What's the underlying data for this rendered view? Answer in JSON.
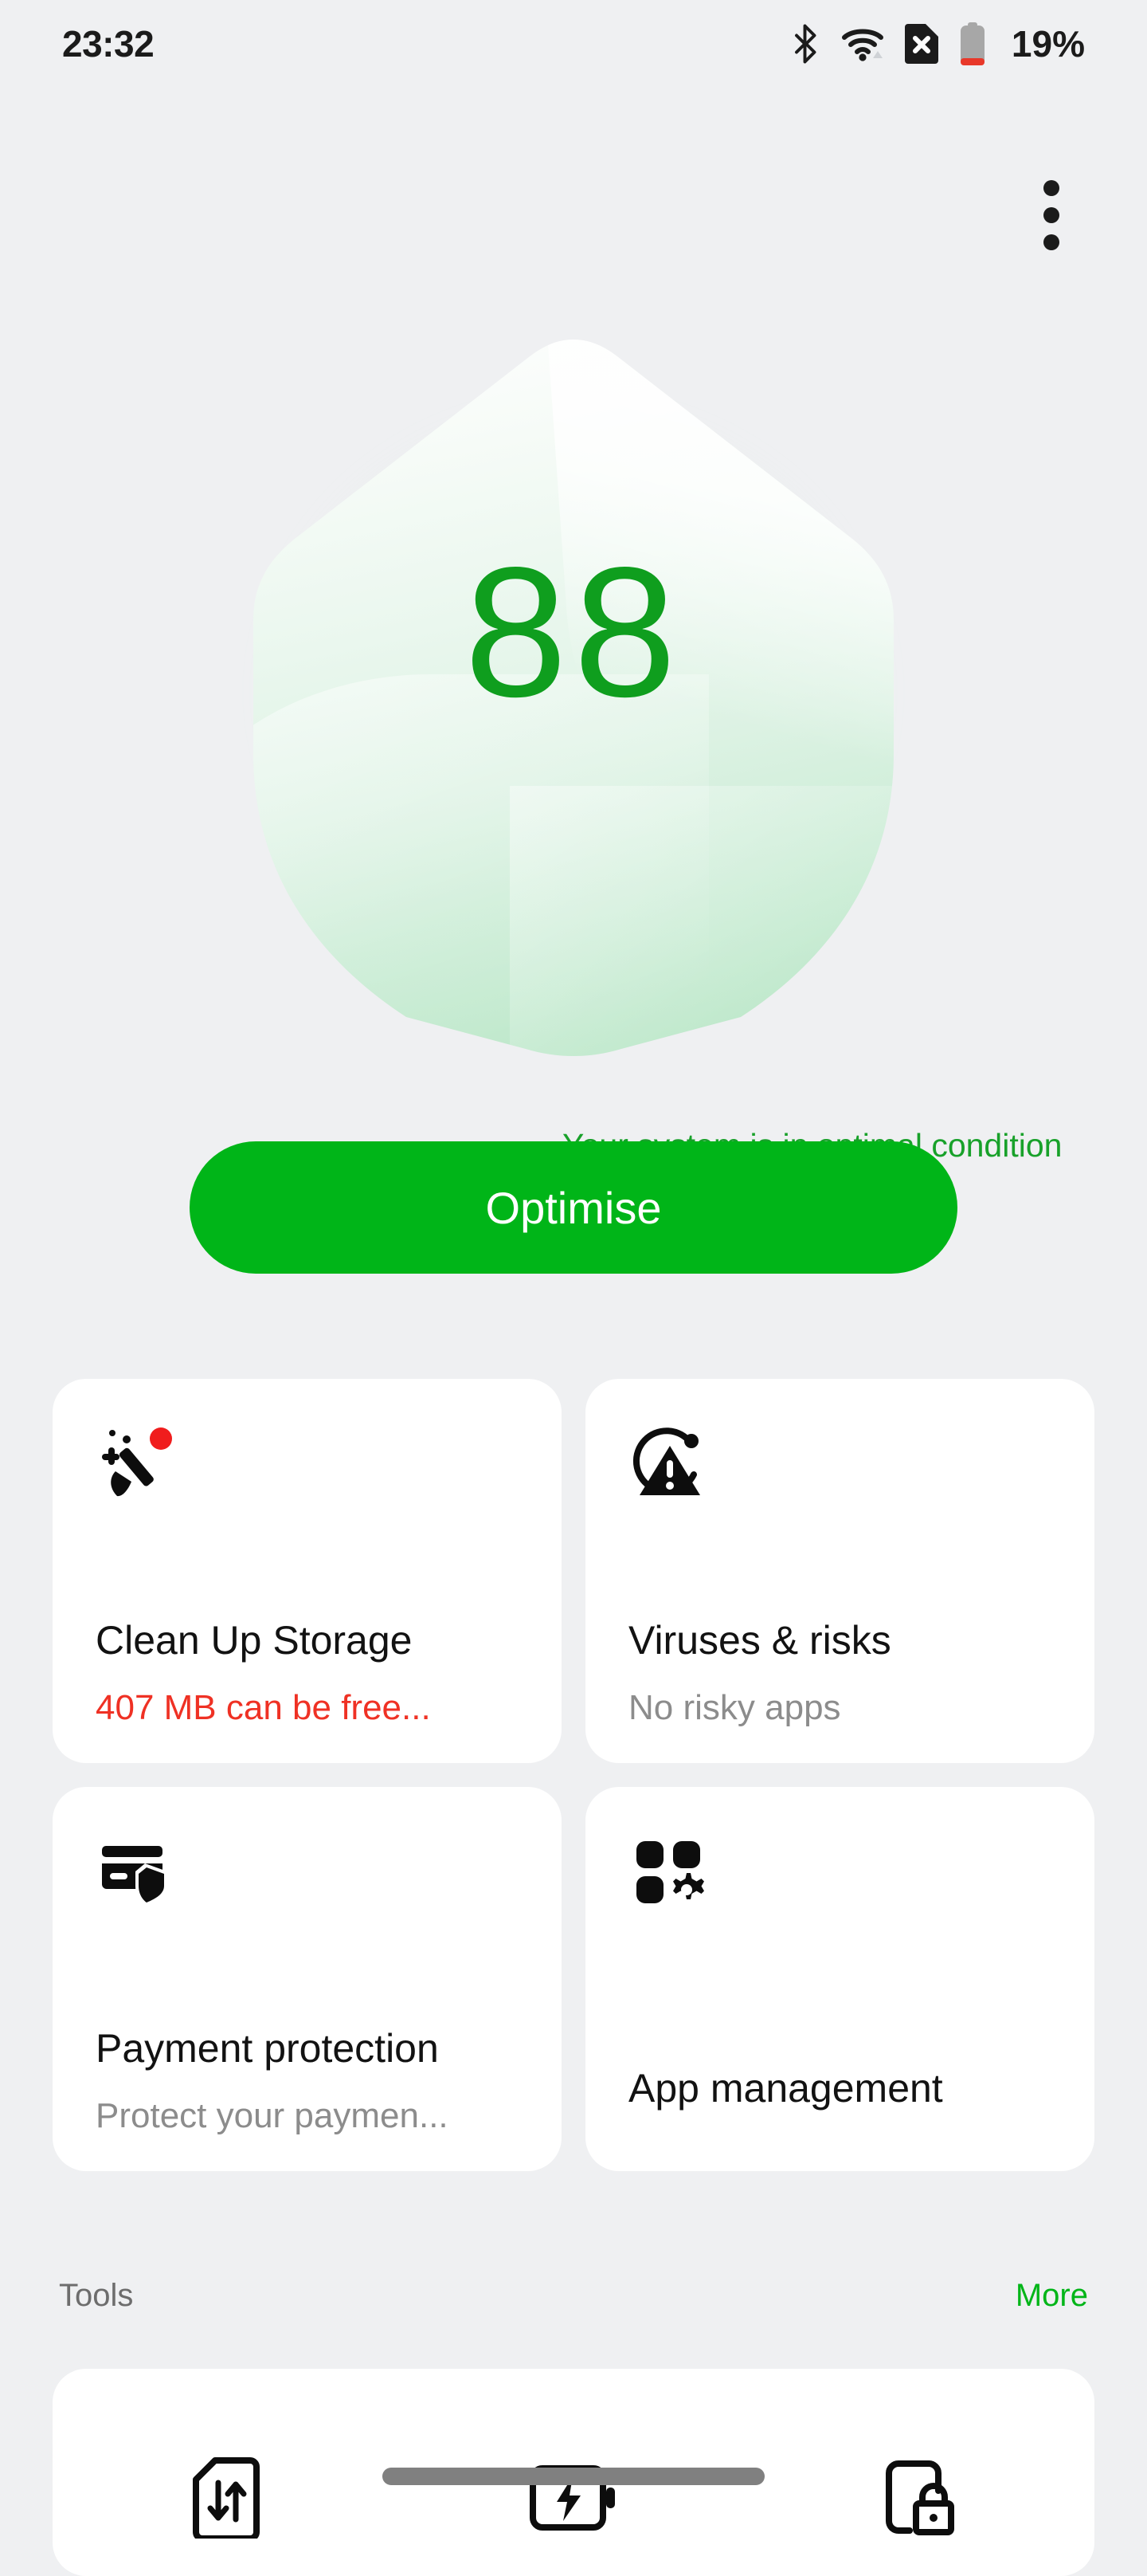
{
  "status_bar": {
    "time": "23:32",
    "battery_percent": "19%",
    "icons": [
      "bluetooth-icon",
      "wifi-icon",
      "sim-card-error-icon",
      "battery-low-icon"
    ]
  },
  "header": {
    "overflow_menu": "overflow-menu"
  },
  "hero": {
    "score": "88",
    "tagline": "Your system is in optimal condition",
    "tagline_visible": "Your system is in optimal condi",
    "score_color": "#0f9e1e",
    "tagline_color": "#18a12a",
    "shield_glow_color": "#5ccd78"
  },
  "primary_action": {
    "label": "Optimise",
    "color": "#00b518",
    "text_color": "#ffffff"
  },
  "cards": [
    {
      "icon": "broom-sparkle-icon",
      "title": "Clean Up Storage",
      "subtitle": "407 MB can be free...",
      "subtitle_color": "#ef3124"
    },
    {
      "icon": "virus-warning-icon",
      "title": "Viruses & risks",
      "subtitle": "No risky apps",
      "subtitle_color": "#8c8c8c"
    },
    {
      "icon": "card-shield-icon",
      "title": "Payment protection",
      "subtitle": "Protect your paymen...",
      "subtitle_color": "#8c8c8c"
    },
    {
      "icon": "apps-gear-icon",
      "title": "App management",
      "subtitle": "",
      "subtitle_color": "#8c8c8c"
    }
  ],
  "tools_section": {
    "label": "Tools",
    "more_label": "More",
    "more_color": "#00b518",
    "items": [
      {
        "icon": "sim-data-transfer-icon",
        "name": "data-usage"
      },
      {
        "icon": "battery-bolt-icon",
        "name": "power-saving"
      },
      {
        "icon": "phone-lock-icon",
        "name": "app-lock"
      }
    ]
  },
  "nav_bar": {
    "type": "gesture-bar",
    "color": "#808080"
  }
}
